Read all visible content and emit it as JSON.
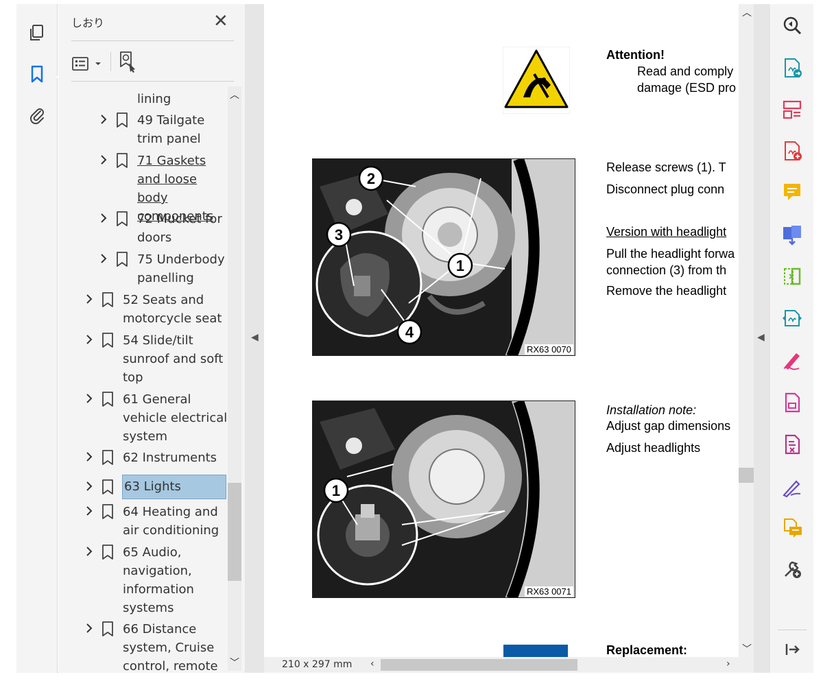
{
  "bookmarks_panel": {
    "title": "しおり",
    "close_glyph": "✕",
    "items": [
      {
        "text": "lining",
        "indent": 1,
        "has_chevron": false,
        "has_flag": false,
        "link": false
      },
      {
        "text": "49 Tailgate trim panel",
        "indent": 1,
        "has_chevron": true,
        "link": false
      },
      {
        "text": "71 Gaskets and loose body components ",
        "indent": 1,
        "has_chevron": true,
        "link": true
      },
      {
        "text": "72 Mucket for doors",
        "indent": 1,
        "has_chevron": true,
        "link": false
      },
      {
        "text": "75 Underbody panelling",
        "indent": 1,
        "has_chevron": true,
        "link": false
      },
      {
        "text": "52 Seats and motorcycle seat",
        "indent": 0,
        "has_chevron": true,
        "link": false
      },
      {
        "text": "54 Slide/tilt sunroof and soft top",
        "indent": 0,
        "has_chevron": true,
        "link": false
      },
      {
        "text": "61 General vehicle electrical system",
        "indent": 0,
        "has_chevron": true,
        "link": false
      },
      {
        "text": "62 Instruments",
        "indent": 0,
        "has_chevron": true,
        "link": false
      },
      {
        "text": "63 Lights",
        "indent": 0,
        "has_chevron": true,
        "link": false,
        "selected": true
      },
      {
        "text": "64 Heating and air conditioning",
        "indent": 0,
        "has_chevron": true,
        "link": false
      },
      {
        "text": "65 Audio, navigation, information systems",
        "indent": 0,
        "has_chevron": true,
        "link": false
      },
      {
        "text": "66 Distance system, Cruise control, remote",
        "indent": 0,
        "has_chevron": true,
        "link": false
      }
    ]
  },
  "document": {
    "attention_title": "Attention!",
    "attention_line1": "Read and comply",
    "attention_line2": "damage (ESD pro",
    "step1_line1": "Release screws (1). T",
    "step1_line2": "Disconnect plug conn",
    "version_heading": "Version with headlight",
    "step2_line1": "Pull the headlight forwa",
    "step2_line2": "connection (3) from th",
    "step2_line3": "Remove the headlight",
    "photo1_caption": "RX63 0070",
    "photo2_caption": "RX63 0071",
    "photo1_callouts": [
      "2",
      "3",
      "1",
      "4"
    ],
    "photo2_callouts": [
      "1"
    ],
    "install_heading": "Installation note:",
    "install_line1": "Adjust gap dimensions",
    "install_line2": "Adjust headlights",
    "replacement_heading": "Replacement:"
  },
  "statusbar": {
    "page_size": "210 x 297 mm"
  },
  "left_rail_icons": [
    "pages-icon",
    "bookmark-icon",
    "attachment-icon"
  ],
  "right_rail_icons": [
    "zoom-icon",
    "export-pdf-icon",
    "organize-pages-icon",
    "create-pdf-icon",
    "comment-icon",
    "combine-files-icon",
    "crop-icon",
    "compare-icon",
    "fill-sign-icon",
    "edit-pdf-icon",
    "protect-icon",
    "sign-icon",
    "send-comments-icon",
    "more-tools-icon",
    "collapse-panel-icon"
  ],
  "colors": {
    "accent_blue": "#1473e6",
    "selected_bg": "#a6c8e0",
    "warning_yellow": "#f2d300"
  }
}
